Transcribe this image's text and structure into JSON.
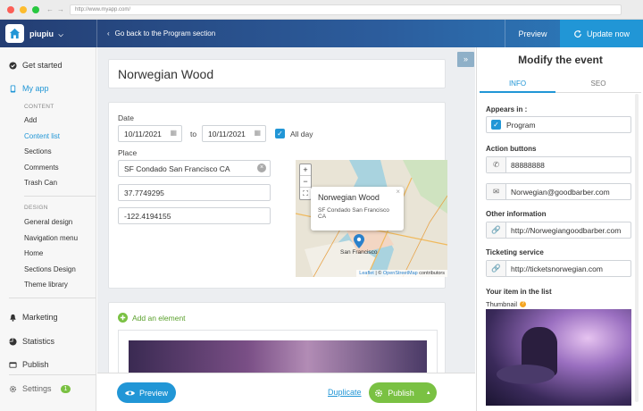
{
  "browser": {
    "url": "http://www.myapp.com/"
  },
  "topbar": {
    "app_name": "piupiu",
    "back_label": "Go back to the Program section",
    "preview_label": "Preview",
    "update_label": "Update now"
  },
  "sidebar": {
    "get_started": "Get started",
    "my_app": "My app",
    "content_section": "CONTENT",
    "content_items": [
      "Add",
      "Content list",
      "Sections",
      "Comments",
      "Trash Can"
    ],
    "design_section": "DESIGN",
    "design_items": [
      "General design",
      "Navigation menu",
      "Home",
      "Sections Design",
      "Theme library"
    ],
    "marketing": "Marketing",
    "statistics": "Statistics",
    "publish": "Publish",
    "settings": "Settings",
    "settings_badge": "1"
  },
  "editor": {
    "event_title": "Norwegian Wood",
    "date_label": "Date",
    "date_from": "10/11/2021",
    "to_label": "to",
    "date_to": "10/11/2021",
    "all_day_label": "All day",
    "place_label": "Place",
    "address": "SF Condado San Francisco CA",
    "latitude": "37.7749295",
    "longitude": "-122.4194155",
    "map_popup_title": "Norwegian Wood",
    "map_popup_address": "SF Condado San Francisco CA",
    "map_city_label": "San Francisco",
    "map_attrib_leaflet": "Leaflet",
    "map_attrib_osm": "OpenStreetMap",
    "map_attrib_suffix": "contributors",
    "add_element_label": "Add an element"
  },
  "bottom": {
    "preview_label": "Preview",
    "duplicate_label": "Duplicate",
    "publish_label": "Publish"
  },
  "panel": {
    "title": "Modify the event",
    "tab_info": "INFO",
    "tab_seo": "SEO",
    "appears_in_label": "Appears in :",
    "appears_in_value": "Program",
    "action_buttons_label": "Action buttons",
    "phone": "88888888",
    "email": "Norwegian@goodbarber.com",
    "other_info_label": "Other information",
    "other_info_url": "http://Norwegiangoodbarber.com",
    "ticketing_label": "Ticketing service",
    "ticketing_url": "http://ticketsnorwegian.com",
    "your_item_label": "Your item in the list",
    "thumbnail_label": "Thumbnail"
  },
  "colors": {
    "accent": "#2196d6",
    "green": "#7ac143",
    "nav_dark": "#243e73"
  }
}
